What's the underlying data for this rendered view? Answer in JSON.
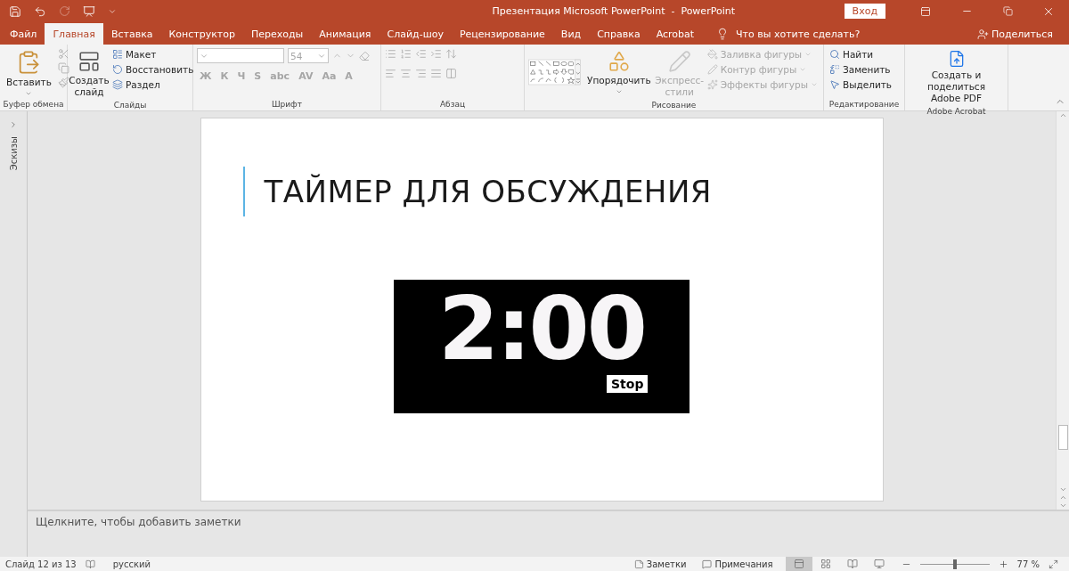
{
  "title_bar": {
    "title": "Презентация Microsoft PowerPoint  -  PowerPoint",
    "sign_in": "Вход"
  },
  "tabs": [
    {
      "label": "Файл",
      "selected": false
    },
    {
      "label": "Главная",
      "selected": true
    },
    {
      "label": "Вставка",
      "selected": false
    },
    {
      "label": "Конструктор",
      "selected": false
    },
    {
      "label": "Переходы",
      "selected": false
    },
    {
      "label": "Анимация",
      "selected": false
    },
    {
      "label": "Слайд-шоу",
      "selected": false
    },
    {
      "label": "Рецензирование",
      "selected": false
    },
    {
      "label": "Вид",
      "selected": false
    },
    {
      "label": "Справка",
      "selected": false
    },
    {
      "label": "Acrobat",
      "selected": false
    }
  ],
  "tell_me": "Что вы хотите сделать?",
  "share": "Поделиться",
  "ribbon": {
    "clipboard": {
      "label": "Буфер обмена",
      "paste": "Вставить"
    },
    "slides": {
      "label": "Слайды",
      "new_slide": "Создать слайд",
      "items": [
        "Макет",
        "Восстановить",
        "Раздел"
      ]
    },
    "font": {
      "label": "Шрифт",
      "size": "54",
      "format_buttons": [
        "Ж",
        "К",
        "Ч",
        "S",
        "abc",
        "AV",
        "Aa",
        "A"
      ],
      "disabled": true
    },
    "paragraph": {
      "label": "Абзац"
    },
    "drawing": {
      "label": "Рисование",
      "arrange": "Упорядочить",
      "quick_styles": "Экспресс-стили",
      "quick_styles_disabled": true,
      "items": [
        {
          "label": "Заливка фигуры",
          "disabled": true
        },
        {
          "label": "Контур фигуры",
          "disabled": true
        },
        {
          "label": "Эффекты фигуры",
          "disabled": true
        }
      ]
    },
    "editing": {
      "label": "Редактирование",
      "items": [
        "Найти",
        "Заменить",
        "Выделить"
      ]
    },
    "acrobat": {
      "label": "Adobe Acrobat",
      "button": "Создать и поделиться Adobe PDF"
    }
  },
  "thumbnails_pane": {
    "label": "Эскизы"
  },
  "slide": {
    "title": "ТАЙМЕР ДЛЯ ОБСУЖДЕНИЯ",
    "timer": "2:00",
    "stop": "Stop"
  },
  "notes": {
    "placeholder": "Щелкните, чтобы добавить заметки"
  },
  "status_bar": {
    "slide_info": "Слайд 12 из 13",
    "language": "русский",
    "notes": "Заметки",
    "comments": "Примечания",
    "views": [
      {
        "kind": "normal",
        "selected": true
      },
      {
        "kind": "sorter",
        "selected": false
      },
      {
        "kind": "reading",
        "selected": false
      },
      {
        "kind": "show",
        "selected": false
      }
    ],
    "zoom": {
      "level": 0.5,
      "reading": "77 %"
    }
  }
}
